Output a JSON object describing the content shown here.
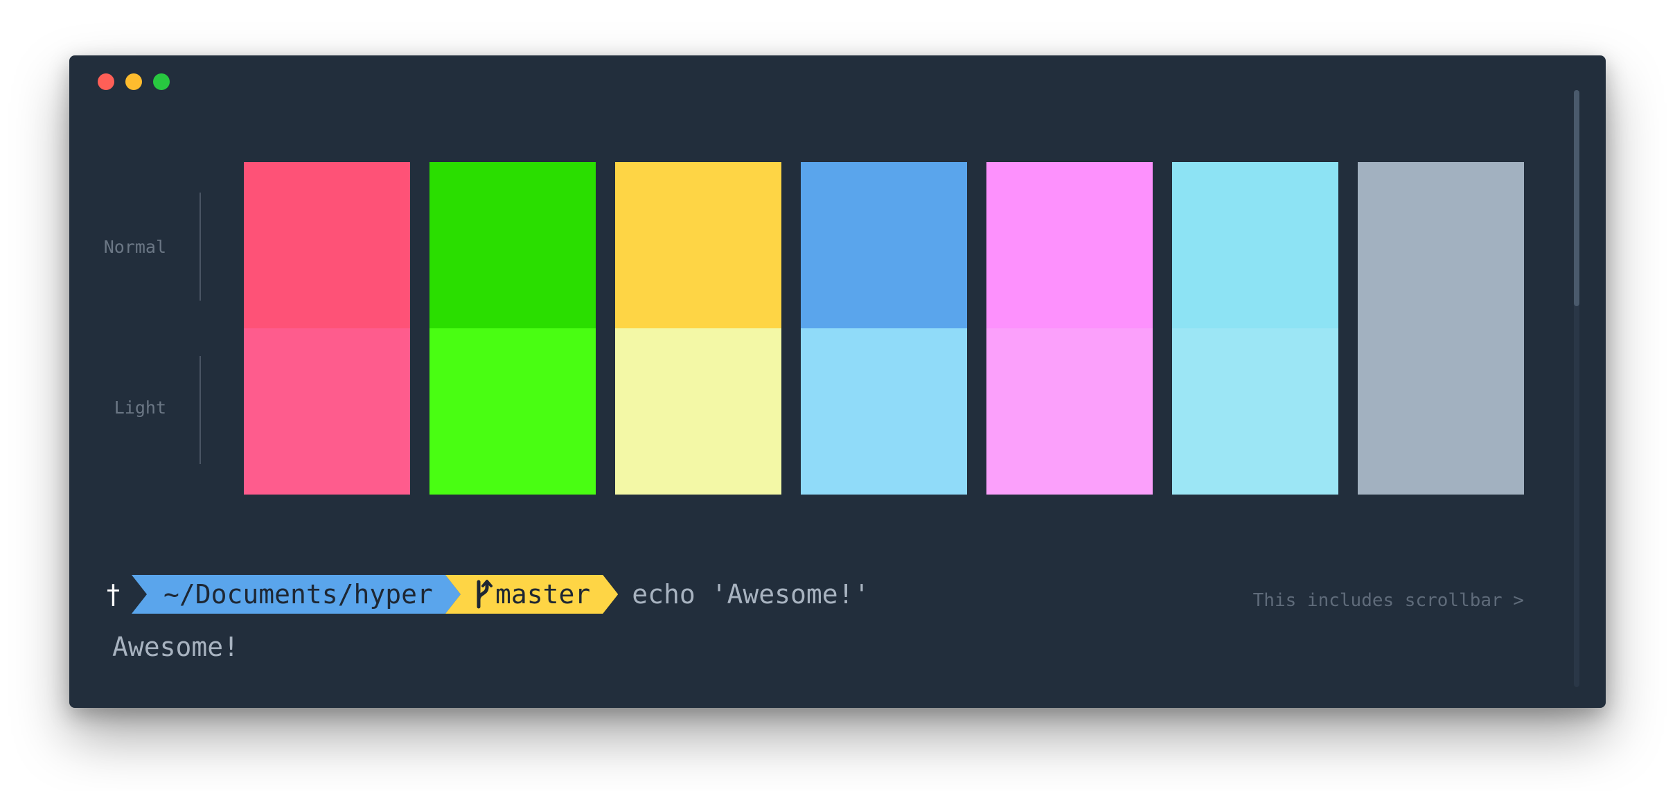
{
  "window": {
    "controls": [
      {
        "name": "close",
        "color": "#fe5f57"
      },
      {
        "name": "minimize",
        "color": "#febc2e"
      },
      {
        "name": "maximize",
        "color": "#28c840"
      }
    ]
  },
  "labels": {
    "normal": "Normal",
    "light": "Light"
  },
  "palette": {
    "normal": [
      "#fe5277",
      "#2ade00",
      "#fed545",
      "#5aa5ec",
      "#fd91fd",
      "#8de3f4",
      "#a2b1c0"
    ],
    "light": [
      "#fe5c8d",
      "#49fe12",
      "#f3f8a6",
      "#90dbf9",
      "#fba0fb",
      "#9ce6f5",
      "#a2b1c0"
    ]
  },
  "prompt": {
    "symbol": "†",
    "path": "~/Documents/hyper",
    "branch_icon": "git-branch-icon",
    "branch": "master",
    "command": "echo 'Awesome!'"
  },
  "output": "Awesome!",
  "hint": "This includes scrollbar >"
}
